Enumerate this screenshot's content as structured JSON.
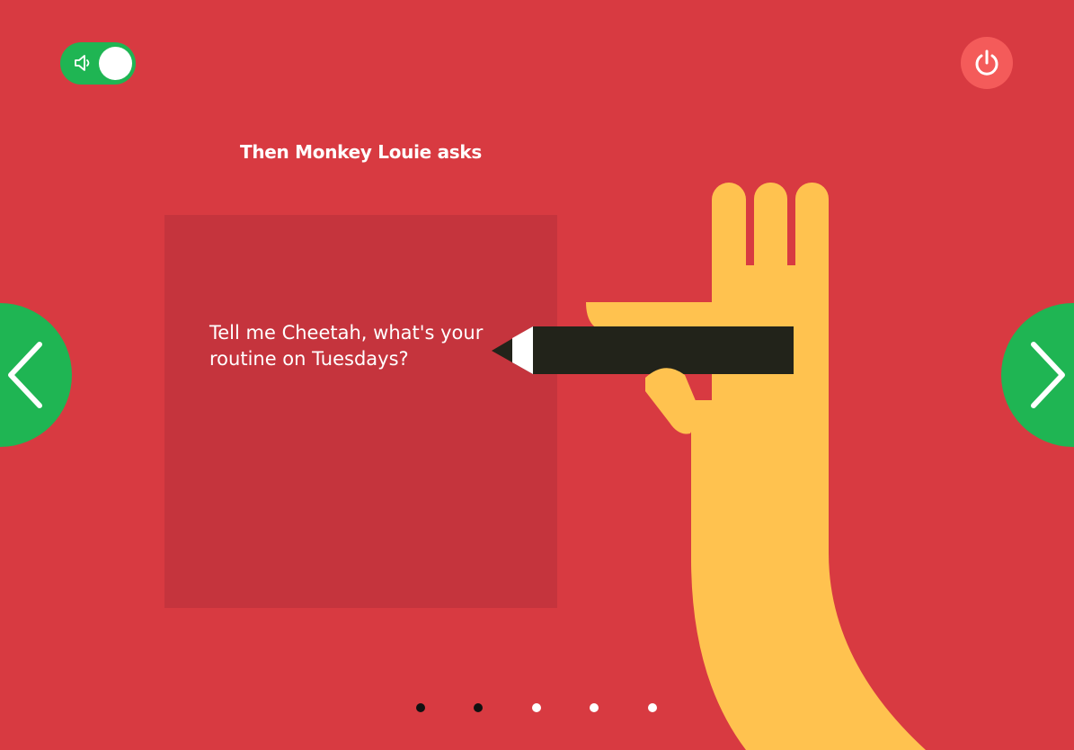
{
  "title": "Then Monkey Louie asks",
  "card": {
    "question": "Tell me Cheetah, what's your routine on Tuesdays?"
  },
  "controls": {
    "sound_icon": "speaker-icon",
    "power_icon": "power-icon",
    "prev_icon": "chevron-left-icon",
    "next_icon": "chevron-right-icon"
  },
  "pagination": {
    "total": 5,
    "dots": [
      "dark",
      "dark",
      "light",
      "light",
      "light"
    ]
  },
  "colors": {
    "background": "#d83a41",
    "card": "#c5343d",
    "green": "#1fb553",
    "power": "#f45b5a",
    "hand": "#ffc24f",
    "pencil": "#22231a"
  }
}
